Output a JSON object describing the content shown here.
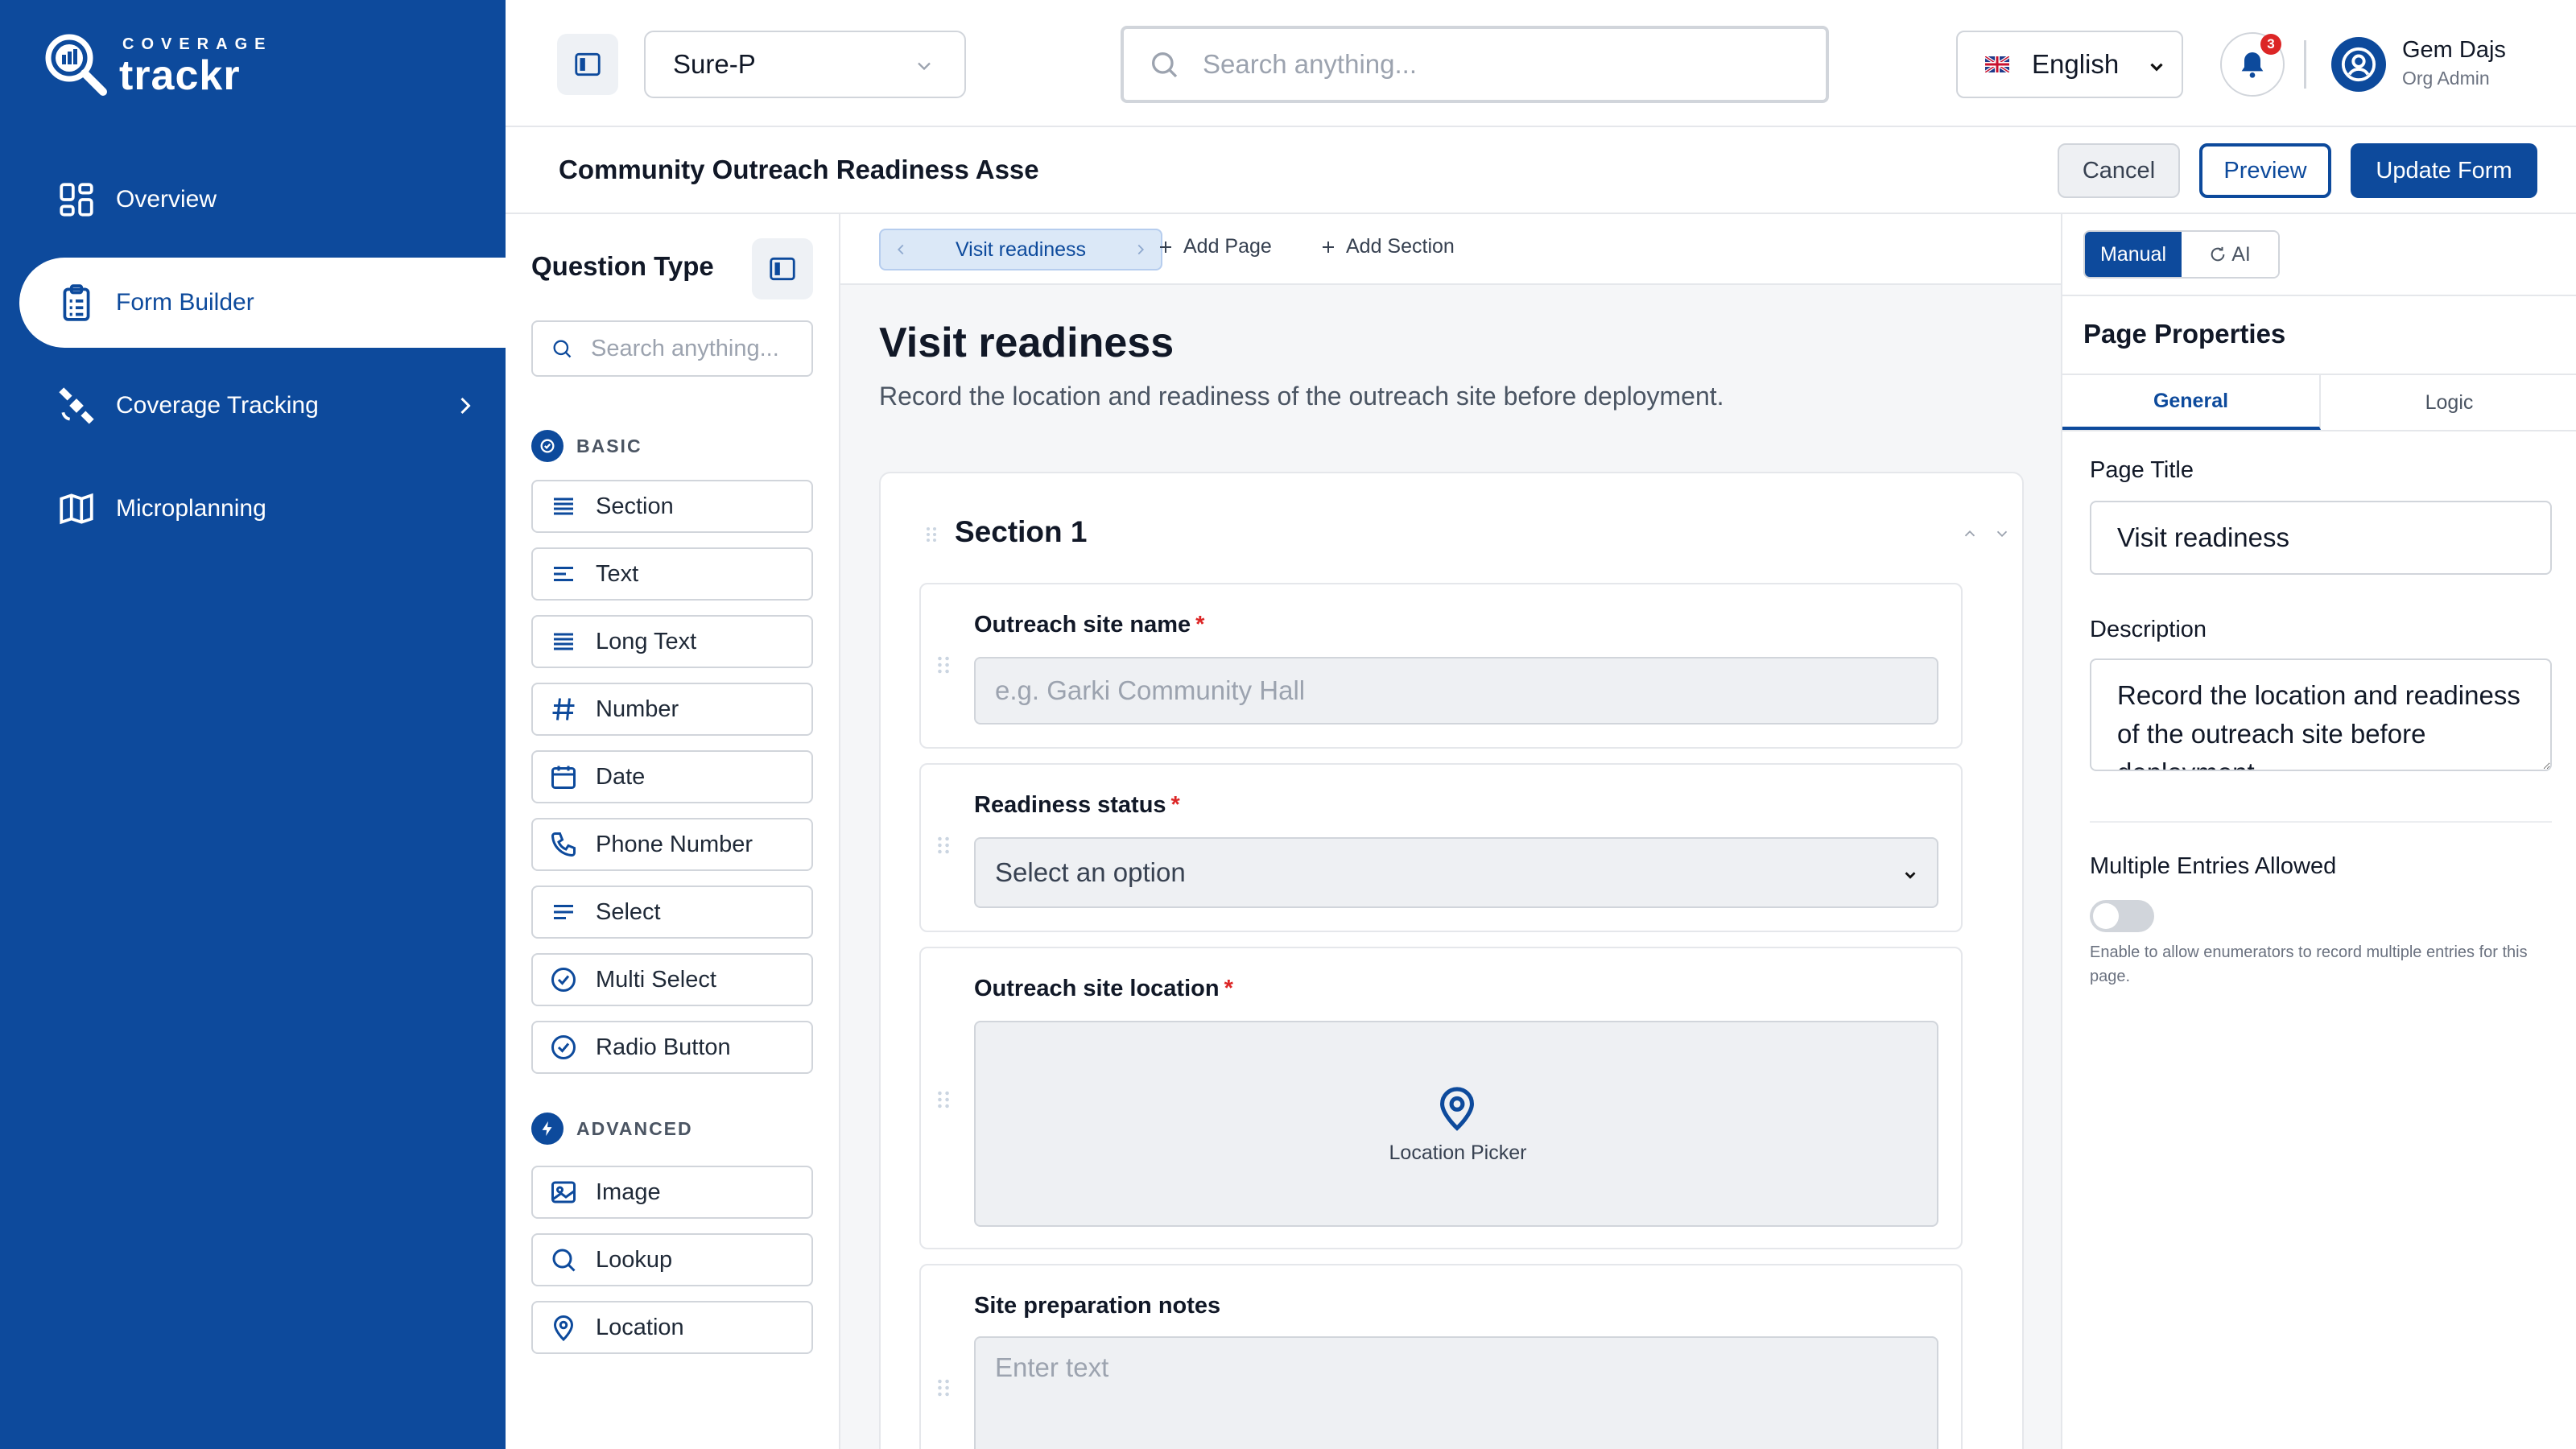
{
  "brand": {
    "top": "COVERAGE",
    "main": "trackr"
  },
  "sidebar": {
    "items": [
      {
        "label": "Overview",
        "icon": "grid-icon"
      },
      {
        "label": "Form Builder",
        "icon": "clipboard-icon",
        "active": true
      },
      {
        "label": "Coverage Tracking",
        "icon": "satellite-icon",
        "has_chevron": true
      },
      {
        "label": "Microplanning",
        "icon": "map-icon"
      }
    ]
  },
  "topbar": {
    "org": "Sure-P",
    "search_placeholder": "Search anything...",
    "language": "English",
    "notifications": "3",
    "user_name": "Gem Dajs",
    "user_role": "Org Admin"
  },
  "formbar": {
    "title": "Community Outreach Readiness Asse",
    "cancel": "Cancel",
    "preview": "Preview",
    "update": "Update Form"
  },
  "question_panel": {
    "title": "Question Type",
    "search_placeholder": "Search anything...",
    "basic_label": "BASIC",
    "basic": [
      "Section",
      "Text",
      "Long Text",
      "Number",
      "Date",
      "Phone Number",
      "Select",
      "Multi Select",
      "Radio Button"
    ],
    "advanced_label": "ADVANCED",
    "advanced": [
      "Image",
      "Lookup",
      "Location"
    ]
  },
  "canvas": {
    "page_tab": "Visit readiness",
    "add_page": "Add Page",
    "add_section": "Add Section",
    "page_title": "Visit readiness",
    "page_description": "Record the location and readiness of the outreach site before deployment.",
    "section_title": "Section 1",
    "fields": {
      "site_name": {
        "label": "Outreach site name",
        "required": "*",
        "placeholder": "e.g. Garki Community Hall"
      },
      "status": {
        "label": "Readiness status",
        "required": "*",
        "value": "Select an option"
      },
      "location": {
        "label": "Outreach site location",
        "required": "*",
        "picker": "Location Picker"
      },
      "notes": {
        "label": "Site preparation notes",
        "placeholder": "Enter text"
      }
    }
  },
  "properties": {
    "mode_manual": "Manual",
    "mode_ai": "AI",
    "title": "Page Properties",
    "tab_general": "General",
    "tab_logic": "Logic",
    "page_title_label": "Page Title",
    "page_title_value": "Visit readiness",
    "description_label": "Description",
    "description_value": "Record the location and readiness of the outreach site before deployment.",
    "multiple_label": "Multiple Entries Allowed",
    "multiple_enabled": false,
    "multiple_help": "Enable to allow enumerators to record multiple entries for this page."
  },
  "colors": {
    "brand": "#0d4a9c",
    "danger": "#dc2626",
    "canvas_bg": "#f5f6f8"
  }
}
